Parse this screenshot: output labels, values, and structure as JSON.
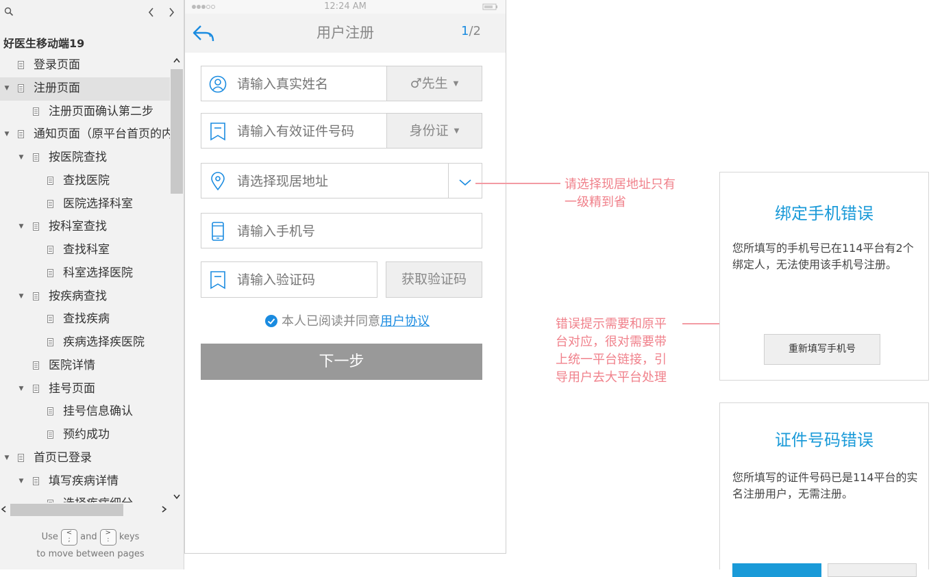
{
  "sidebar": {
    "project_title": "好医生移动端19",
    "tree": [
      {
        "label": "登录页面",
        "level": 0,
        "expandable": false,
        "selected": false
      },
      {
        "label": "注册页面",
        "level": 0,
        "expandable": true,
        "selected": true
      },
      {
        "label": "注册页面确认第二步",
        "level": 1,
        "expandable": false,
        "selected": false
      },
      {
        "label": "通知页面（原平台首页的内",
        "level": 0,
        "expandable": true,
        "selected": false
      },
      {
        "label": "按医院查找",
        "level": 1,
        "expandable": true,
        "selected": false
      },
      {
        "label": "查找医院",
        "level": 2,
        "expandable": false,
        "selected": false
      },
      {
        "label": "医院选择科室",
        "level": 2,
        "expandable": false,
        "selected": false
      },
      {
        "label": "按科室查找",
        "level": 1,
        "expandable": true,
        "selected": false
      },
      {
        "label": "查找科室",
        "level": 2,
        "expandable": false,
        "selected": false
      },
      {
        "label": "科室选择医院",
        "level": 2,
        "expandable": false,
        "selected": false
      },
      {
        "label": "按疾病查找",
        "level": 1,
        "expandable": true,
        "selected": false
      },
      {
        "label": "查找疾病",
        "level": 2,
        "expandable": false,
        "selected": false
      },
      {
        "label": "疾病选择疾医院",
        "level": 2,
        "expandable": false,
        "selected": false
      },
      {
        "label": "医院详情",
        "level": 1,
        "expandable": false,
        "selected": false
      },
      {
        "label": "挂号页面",
        "level": 1,
        "expandable": true,
        "selected": false
      },
      {
        "label": "挂号信息确认",
        "level": 2,
        "expandable": false,
        "selected": false
      },
      {
        "label": "预约成功",
        "level": 2,
        "expandable": false,
        "selected": false
      },
      {
        "label": "首页已登录",
        "level": 0,
        "expandable": true,
        "selected": false
      },
      {
        "label": "填写疾病详情",
        "level": 1,
        "expandable": true,
        "selected": false
      },
      {
        "label": "选择疾病细分",
        "level": 2,
        "expandable": false,
        "selected": false
      }
    ],
    "footer": {
      "use": "Use",
      "key_prev": "<\n;",
      "and": "and",
      "key_next": ">\n:",
      "keys": "keys",
      "line2": "to move between pages"
    }
  },
  "phone": {
    "status_time": "12:24 AM",
    "nav_title": "用户注册",
    "page_current": "1",
    "page_total": "/2",
    "fields": {
      "name_placeholder": "请输入真实姓名",
      "gender_value": "♂先生",
      "id_placeholder": "请输入有效证件号码",
      "id_type_value": "身份证",
      "address_placeholder": "请选择现居地址",
      "phone_placeholder": "请输入手机号",
      "code_placeholder": "请输入验证码"
    },
    "get_code_label": "获取验证码",
    "agree_text": "本人已阅读并同意",
    "agree_link": "用户协议",
    "agree_checked": true,
    "next_label": "下一步"
  },
  "annotations": {
    "address_note": [
      "请选择现居地址只有",
      "一级精到省"
    ],
    "error_note": [
      "错误提示需要和原平",
      "台对应，很对需要带",
      "上统一平台链接，引",
      "导用户去大平台处理"
    ]
  },
  "cards": {
    "phone_error": {
      "title": "绑定手机错误",
      "body": "您所填写的手机号已在114平台有2个绑定人，无法使用该手机号注册。",
      "button": "重新填写手机号"
    },
    "id_error": {
      "title": "证件号码错误",
      "body": "您所填写的证件号码已是114平台的实名注册用户，无需注册。"
    }
  },
  "colors": {
    "accent_blue": "#1a8be0",
    "card_title_blue": "#1a9ad8",
    "annotation_pink": "#f0818b",
    "next_button_gray": "#999999"
  }
}
